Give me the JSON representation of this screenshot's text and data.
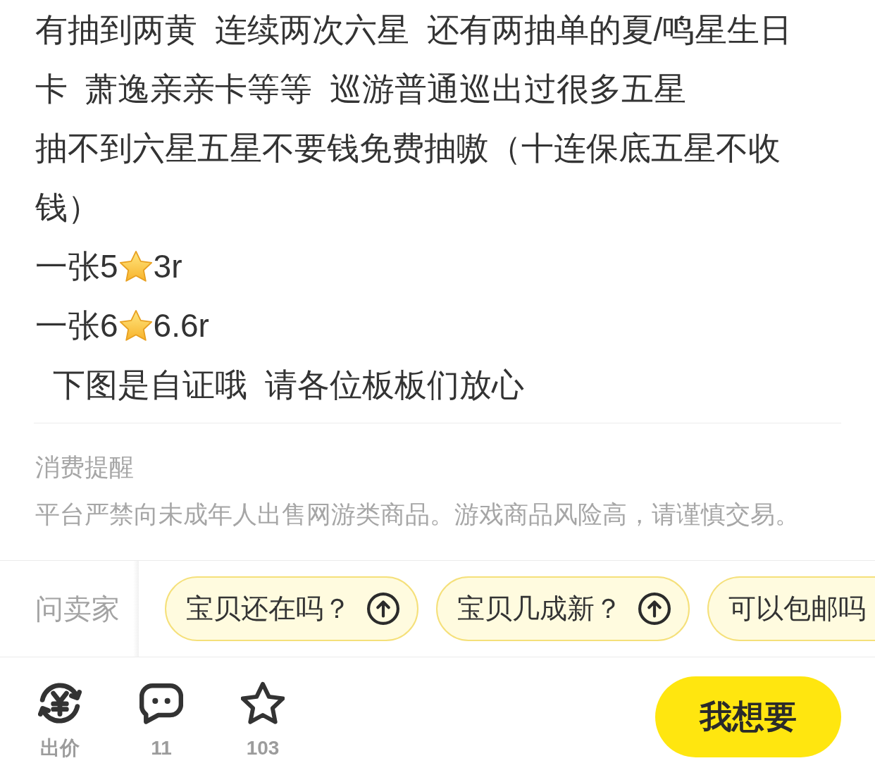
{
  "description": [
    {
      "kind": "text",
      "text": "有抽到两黄 连续两次六星 还有两抽单的夏/鸣星生日卡 萧逸亲亲卡等等 巡游普通巡出过很多五星"
    },
    {
      "kind": "text",
      "text": "抽不到六星五星不要钱免费抽嗷（十连保底五星不收钱）"
    },
    {
      "kind": "price",
      "before": "一张5",
      "after": "3r"
    },
    {
      "kind": "price",
      "before": "一张6",
      "after": "6.6r"
    },
    {
      "kind": "text",
      "text": " 下图是自证哦 请各位板板们放心"
    }
  ],
  "reminder": {
    "title": "消费提醒",
    "text": "平台严禁向未成年人出售网游类商品。游戏商品风险高，请谨慎交易。"
  },
  "ask_seller": {
    "label": "问卖家",
    "questions": [
      {
        "text": "宝贝还在吗？",
        "cut_off": false
      },
      {
        "text": "宝贝几成新？",
        "cut_off": false
      },
      {
        "text": "可以包邮吗",
        "cut_off": true
      }
    ]
  },
  "action_bar": {
    "actions": [
      {
        "kind": "offer",
        "label": "出价"
      },
      {
        "kind": "comment",
        "label": "11"
      },
      {
        "kind": "favorite",
        "label": "103"
      }
    ],
    "primary_button": "我想要"
  }
}
